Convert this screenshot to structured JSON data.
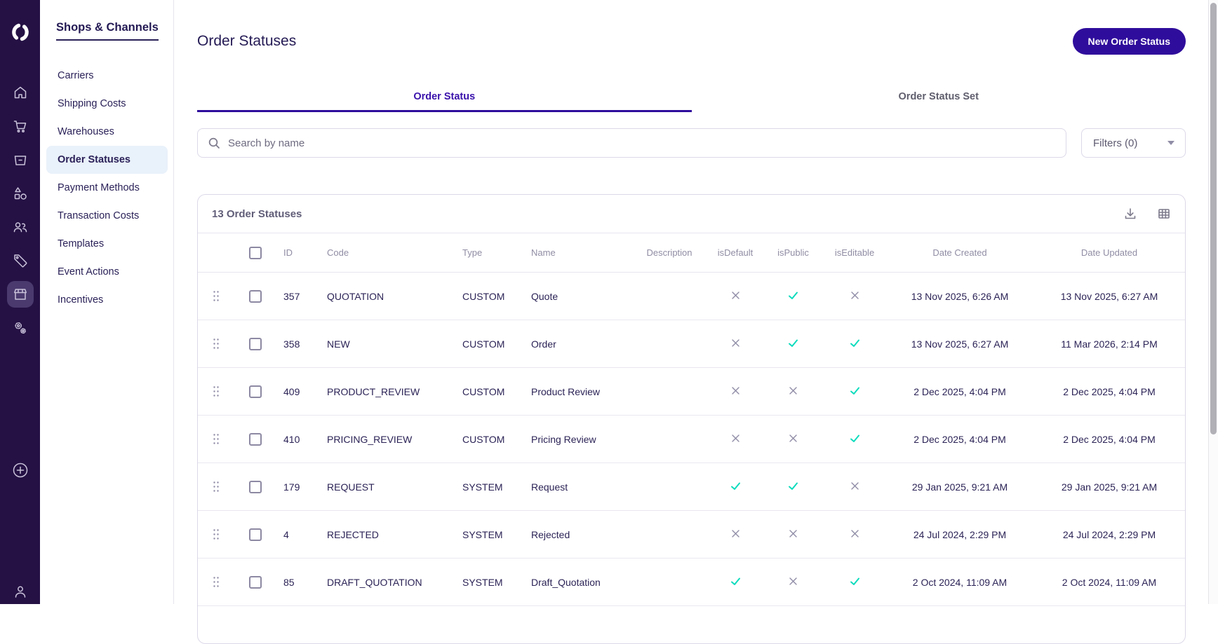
{
  "colors": {
    "accent": "#2f0d9c",
    "sidebar_bg": "#251144",
    "check": "#0ddcbd",
    "cross": "#8f8ca6",
    "active_nav_bg": "#e9f1fa"
  },
  "sidebar": {
    "icon_names": [
      "logo",
      "home",
      "cart",
      "orders-box",
      "catalog-shapes",
      "customers-people",
      "tag",
      "store",
      "settings-gears",
      "add-plus",
      "account-person"
    ],
    "active_icon": "store"
  },
  "subnav": {
    "title": "Shops & Channels",
    "items": [
      {
        "label": "Carriers",
        "active": false
      },
      {
        "label": "Shipping Costs",
        "active": false
      },
      {
        "label": "Warehouses",
        "active": false
      },
      {
        "label": "Order Statuses",
        "active": true
      },
      {
        "label": "Payment Methods",
        "active": false
      },
      {
        "label": "Transaction Costs",
        "active": false
      },
      {
        "label": "Templates",
        "active": false
      },
      {
        "label": "Event Actions",
        "active": false
      },
      {
        "label": "Incentives",
        "active": false
      }
    ]
  },
  "page": {
    "title": "Order Statuses",
    "new_button": "New Order Status"
  },
  "tabs": [
    {
      "label": "Order Status",
      "active": true
    },
    {
      "label": "Order Status Set",
      "active": false
    }
  ],
  "search": {
    "placeholder": "Search by name"
  },
  "filters": {
    "label": "Filters (0)"
  },
  "table": {
    "count_label": "13 Order Statuses",
    "columns": [
      "ID",
      "Code",
      "Type",
      "Name",
      "Description",
      "isDefault",
      "isPublic",
      "isEditable",
      "Date Created",
      "Date Updated"
    ],
    "rows": [
      {
        "id": "357",
        "code": "QUOTATION",
        "type": "CUSTOM",
        "name": "Quote",
        "description": "",
        "isDefault": false,
        "isPublic": true,
        "isEditable": false,
        "dateCreated": "13 Nov 2025, 6:26 AM",
        "dateUpdated": "13 Nov 2025, 6:27 AM"
      },
      {
        "id": "358",
        "code": "NEW",
        "type": "CUSTOM",
        "name": "Order",
        "description": "",
        "isDefault": false,
        "isPublic": true,
        "isEditable": true,
        "dateCreated": "13 Nov 2025, 6:27 AM",
        "dateUpdated": "11 Mar 2026, 2:14 PM"
      },
      {
        "id": "409",
        "code": "PRODUCT_REVIEW",
        "type": "CUSTOM",
        "name": "Product Review",
        "description": "",
        "isDefault": false,
        "isPublic": false,
        "isEditable": true,
        "dateCreated": "2 Dec 2025, 4:04 PM",
        "dateUpdated": "2 Dec 2025, 4:04 PM"
      },
      {
        "id": "410",
        "code": "PRICING_REVIEW",
        "type": "CUSTOM",
        "name": "Pricing Review",
        "description": "",
        "isDefault": false,
        "isPublic": false,
        "isEditable": true,
        "dateCreated": "2 Dec 2025, 4:04 PM",
        "dateUpdated": "2 Dec 2025, 4:04 PM"
      },
      {
        "id": "179",
        "code": "REQUEST",
        "type": "SYSTEM",
        "name": "Request",
        "description": "",
        "isDefault": true,
        "isPublic": true,
        "isEditable": false,
        "dateCreated": "29 Jan 2025, 9:21 AM",
        "dateUpdated": "29 Jan 2025, 9:21 AM"
      },
      {
        "id": "4",
        "code": "REJECTED",
        "type": "SYSTEM",
        "name": "Rejected",
        "description": "",
        "isDefault": false,
        "isPublic": false,
        "isEditable": false,
        "dateCreated": "24 Jul 2024, 2:29 PM",
        "dateUpdated": "24 Jul 2024, 2:29 PM"
      },
      {
        "id": "85",
        "code": "DRAFT_QUOTATION",
        "type": "SYSTEM",
        "name": "Draft_Quotation",
        "description": "",
        "isDefault": true,
        "isPublic": false,
        "isEditable": true,
        "dateCreated": "2 Oct 2024, 11:09 AM",
        "dateUpdated": "2 Oct 2024, 11:09 AM"
      }
    ]
  }
}
